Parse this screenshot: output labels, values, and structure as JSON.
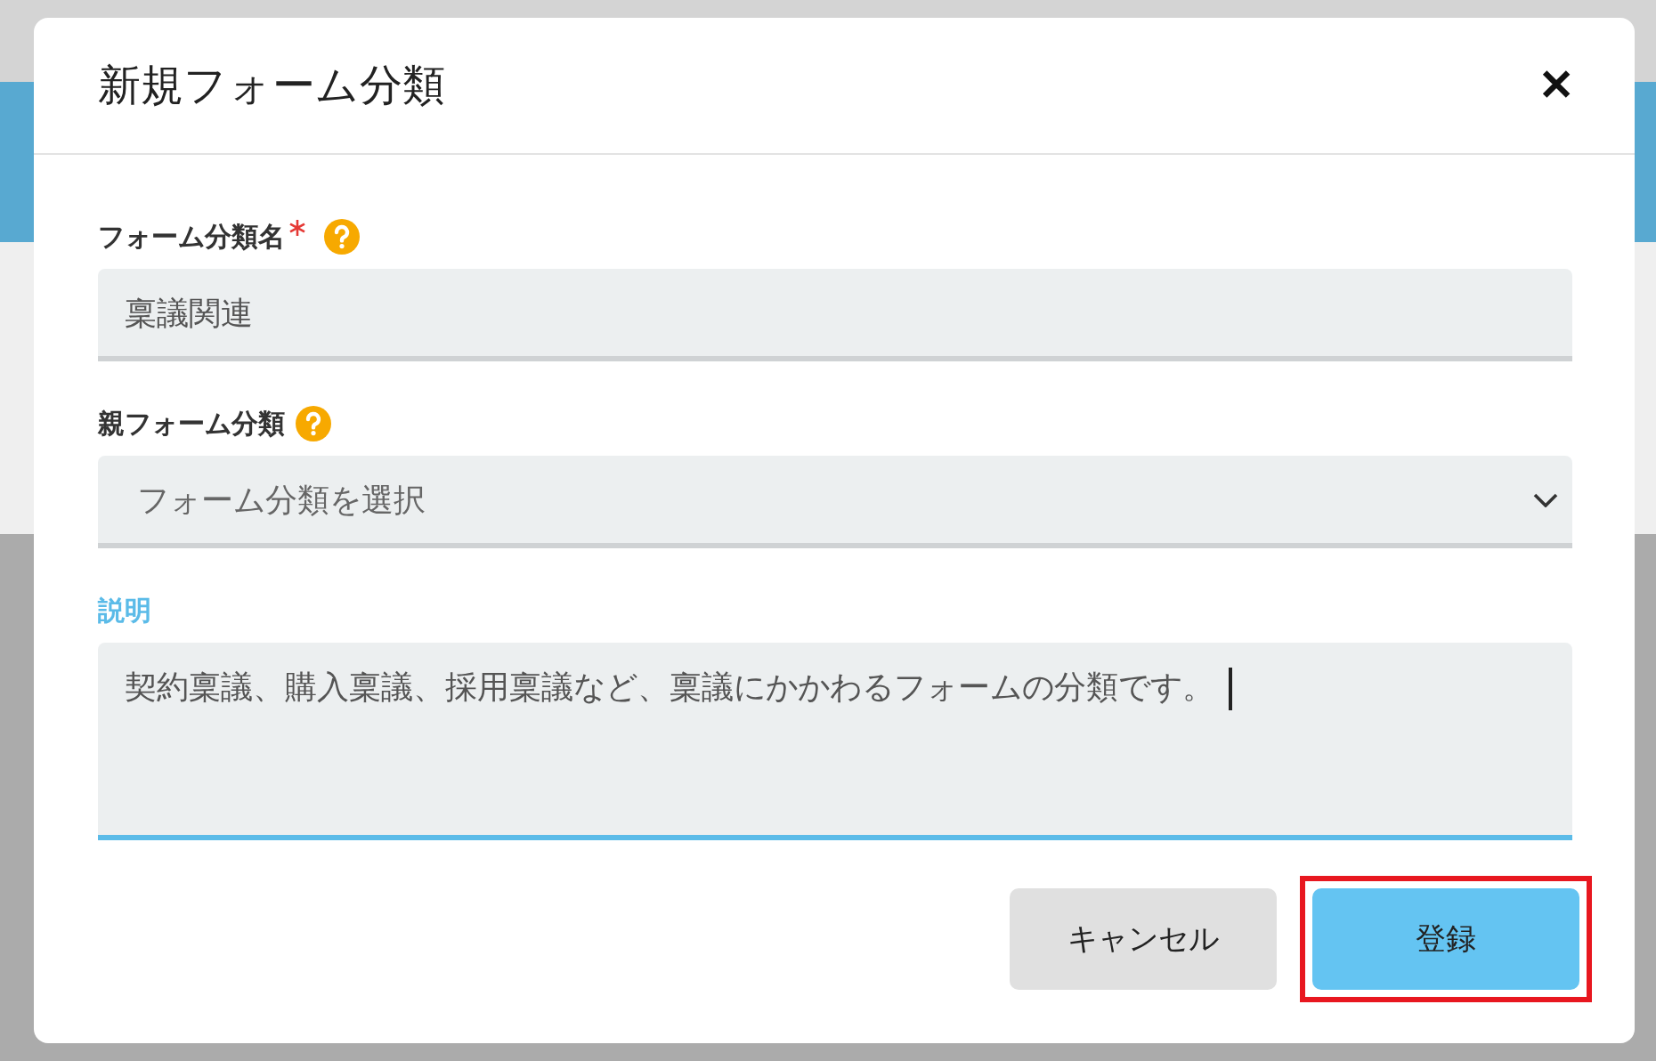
{
  "dialog": {
    "title": "新規フォーム分類",
    "close": "✕"
  },
  "fields": [
    {
      "kind": "text",
      "label": "フォーム分類名",
      "required": true,
      "help": true,
      "focused": false,
      "value": "稟議関連"
    },
    {
      "kind": "select",
      "label": "親フォーム分類",
      "required": false,
      "help": true,
      "focused": false,
      "placeholder": "フォーム分類を選択"
    },
    {
      "kind": "textarea",
      "label": "説明",
      "required": false,
      "help": false,
      "focused": true,
      "value": "契約稟議、購入稟議、採用稟議など、稟議にかかわるフォームの分類です。"
    }
  ],
  "buttons": [
    {
      "label": "キャンセル",
      "kind": "cancel",
      "highlighted": false
    },
    {
      "label": "登録",
      "kind": "primary",
      "highlighted": true
    }
  ]
}
